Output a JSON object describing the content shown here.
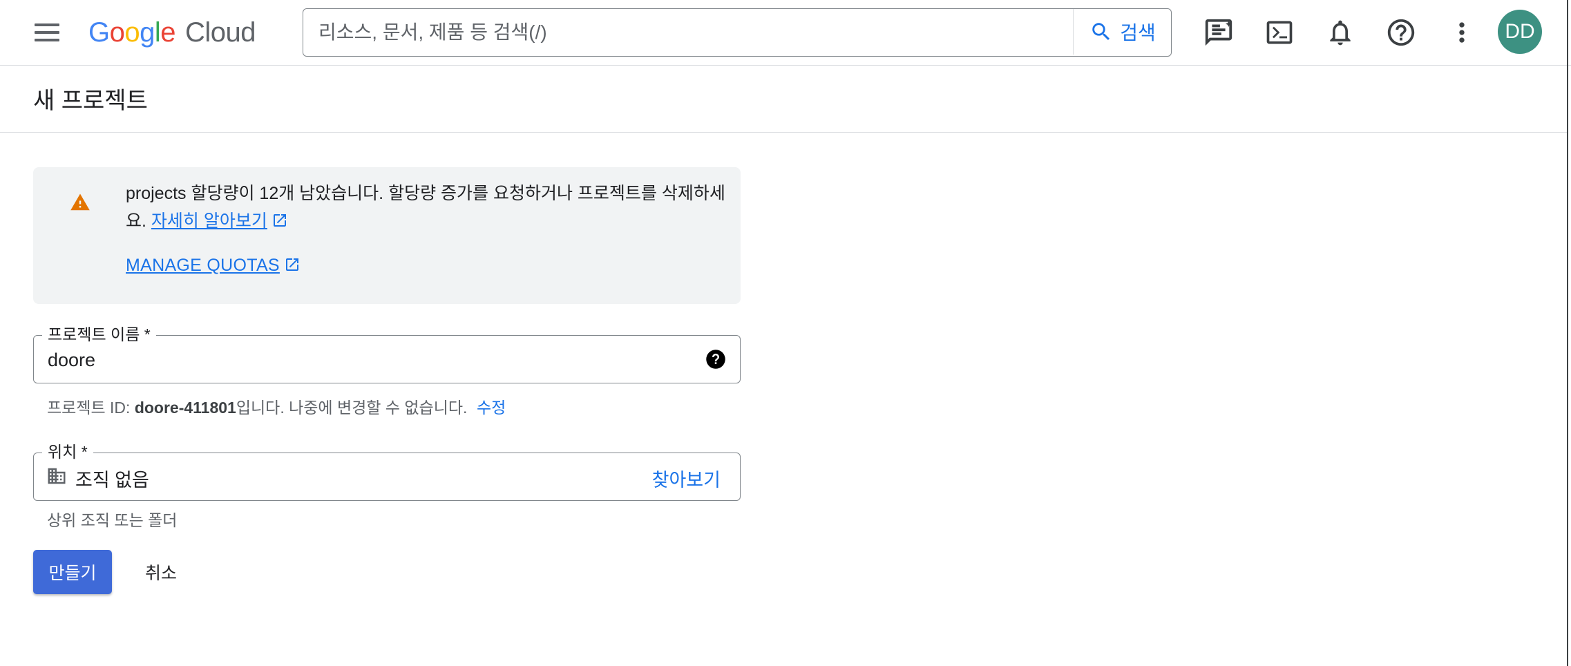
{
  "header": {
    "logo_google": "Google",
    "logo_cloud": "Cloud",
    "search_placeholder": "리소스, 문서, 제품 등 검색(/)",
    "search_button": "검색",
    "avatar_initials": "DD"
  },
  "page": {
    "title": "새 프로젝트"
  },
  "notice": {
    "text": "projects 할당량이 12개 남았습니다. 할당량 증가를 요청하거나 프로젝트를 삭제하세요.",
    "learn_more": "자세히 알아보기",
    "manage_quotas": "MANAGE QUOTAS"
  },
  "project_name": {
    "label": "프로젝트 이름 *",
    "value": "doore"
  },
  "project_id_hint": {
    "prefix": "프로젝트 ID: ",
    "id": "doore-411801",
    "suffix": "입니다. 나중에 변경할 수 없습니다.",
    "edit": "수정"
  },
  "location": {
    "label": "위치 *",
    "value": "조직 없음",
    "browse": "찾아보기",
    "hint": "상위 조직 또는 폴더"
  },
  "actions": {
    "create": "만들기",
    "cancel": "취소"
  },
  "colors": {
    "accent": "#1a73e8",
    "primary_button": "#3f6ad8",
    "warning": "#e37400",
    "avatar": "#3d9182"
  },
  "icons": [
    "menu-icon",
    "search-icon",
    "feedback-icon",
    "cloud-shell-icon",
    "notifications-icon",
    "help-icon",
    "more-vert-icon",
    "warning-icon",
    "open-in-new-icon",
    "help-circle-icon",
    "organization-icon"
  ]
}
